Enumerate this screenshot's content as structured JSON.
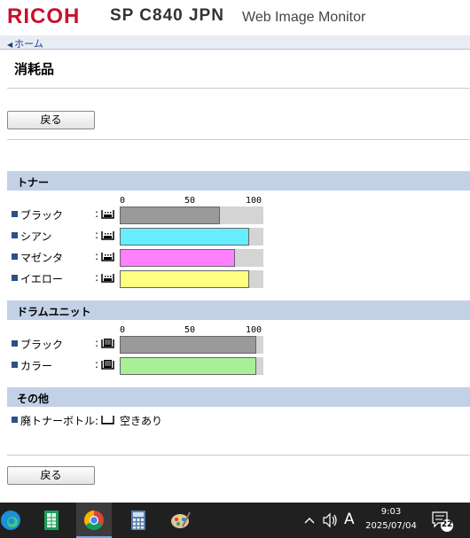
{
  "header": {
    "logo": "RICOH",
    "model": "SP C840 JPN",
    "app": "Web Image Monitor"
  },
  "breadcrumb": {
    "home": "ホーム"
  },
  "page_title": "消耗品",
  "back_label": "戻る",
  "sections": {
    "toner": {
      "title": "トナー",
      "scale": [
        "0",
        "50",
        "100"
      ],
      "items": [
        {
          "label": "ブラック",
          "level": 70,
          "color": "#9a9a9a"
        },
        {
          "label": "シアン",
          "level": 90,
          "color": "#66eeff"
        },
        {
          "label": "マゼンタ",
          "level": 80,
          "color": "#ff80ff"
        },
        {
          "label": "イエロー",
          "level": 90,
          "color": "#ffff80"
        }
      ]
    },
    "drum": {
      "title": "ドラムユニット",
      "scale": [
        "0",
        "50",
        "100"
      ],
      "items": [
        {
          "label": "ブラック",
          "level": 95,
          "color": "#9a9a9a"
        },
        {
          "label": "カラー",
          "level": 95,
          "color": "#a8f098"
        }
      ]
    },
    "other": {
      "title": "その他",
      "item_label": "廃トナーボトル",
      "item_value": "空きあり"
    }
  },
  "taskbar": {
    "time": "9:03",
    "date": "2025/07/04",
    "ime": "A",
    "notifications": "22"
  }
}
